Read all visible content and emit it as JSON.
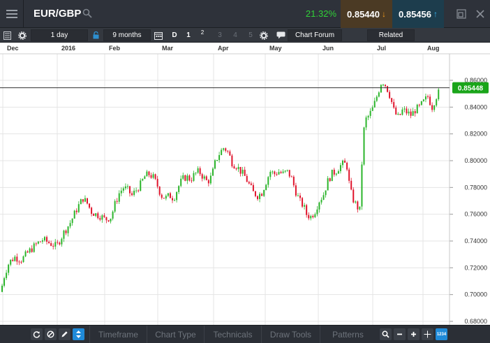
{
  "header": {
    "symbol": "EUR/GBP",
    "change_pct": "21.32%",
    "sell_price": "0.85440",
    "buy_price": "0.85456",
    "colors": {
      "sell_bg": "#4b3a24",
      "buy_bg": "#1d3d4d",
      "change": "#31d138",
      "sell_arrow": "#f39a1c",
      "buy_arrow": "#35b4f2"
    }
  },
  "toolbar": {
    "interval": "1 day",
    "range": "9 months",
    "period_d": "D",
    "period_1": "1",
    "period_2": "2",
    "period_3": "3",
    "period_4": "4",
    "period_5": "5",
    "chart_forum": "Chart Forum",
    "related": "Related"
  },
  "bottom": {
    "tabs": [
      "Timeframe",
      "Chart Type",
      "Technicals",
      "Draw Tools",
      "Patterns"
    ],
    "scale_badge": "1234"
  },
  "chart_data": {
    "type": "candlestick",
    "x_labels": [
      "Dec",
      "2016",
      "Feb",
      "Mar",
      "Apr",
      "May",
      "Jun",
      "Jul",
      "Aug"
    ],
    "y_ticks": [
      "0.86000",
      "0.84000",
      "0.82000",
      "0.80000",
      "0.78000",
      "0.76000",
      "0.74000",
      "0.72000",
      "0.70000",
      "0.68000"
    ],
    "ylim": [
      0.676,
      0.866
    ],
    "current_price": "0.85448",
    "current_value": 0.85448,
    "up_color": "#2bb52b",
    "down_color": "#e0142c",
    "price_label_color": "#1aa51a",
    "path": [
      [
        0,
        0.702
      ],
      [
        6,
        0.716
      ],
      [
        12,
        0.724
      ],
      [
        20,
        0.728
      ],
      [
        30,
        0.726
      ],
      [
        40,
        0.732
      ],
      [
        52,
        0.738
      ],
      [
        60,
        0.741
      ],
      [
        72,
        0.738
      ],
      [
        80,
        0.736
      ],
      [
        90,
        0.746
      ],
      [
        100,
        0.754
      ],
      [
        110,
        0.765
      ],
      [
        118,
        0.772
      ],
      [
        124,
        0.768
      ],
      [
        130,
        0.762
      ],
      [
        136,
        0.76
      ],
      [
        142,
        0.759
      ],
      [
        150,
        0.756
      ],
      [
        158,
        0.758
      ],
      [
        164,
        0.768
      ],
      [
        170,
        0.776
      ],
      [
        176,
        0.78
      ],
      [
        182,
        0.778
      ],
      [
        188,
        0.774
      ],
      [
        194,
        0.778
      ],
      [
        200,
        0.782
      ],
      [
        206,
        0.788
      ],
      [
        212,
        0.79
      ],
      [
        218,
        0.788
      ],
      [
        224,
        0.782
      ],
      [
        230,
        0.774
      ],
      [
        236,
        0.772
      ],
      [
        242,
        0.774
      ],
      [
        248,
        0.772
      ],
      [
        254,
        0.78
      ],
      [
        260,
        0.786
      ],
      [
        266,
        0.788
      ],
      [
        272,
        0.786
      ],
      [
        278,
        0.79
      ],
      [
        284,
        0.792
      ],
      [
        290,
        0.788
      ],
      [
        296,
        0.784
      ],
      [
        302,
        0.788
      ],
      [
        308,
        0.8
      ],
      [
        314,
        0.806
      ],
      [
        320,
        0.81
      ],
      [
        326,
        0.806
      ],
      [
        332,
        0.798
      ],
      [
        338,
        0.796
      ],
      [
        344,
        0.792
      ],
      [
        350,
        0.788
      ],
      [
        356,
        0.782
      ],
      [
        362,
        0.776
      ],
      [
        368,
        0.774
      ],
      [
        374,
        0.776
      ],
      [
        380,
        0.784
      ],
      [
        386,
        0.792
      ],
      [
        392,
        0.79
      ],
      [
        398,
        0.792
      ],
      [
        404,
        0.79
      ],
      [
        410,
        0.792
      ],
      [
        416,
        0.788
      ],
      [
        422,
        0.778
      ],
      [
        428,
        0.77
      ],
      [
        434,
        0.766
      ],
      [
        438,
        0.76
      ],
      [
        444,
        0.758
      ],
      [
        450,
        0.762
      ],
      [
        456,
        0.77
      ],
      [
        462,
        0.774
      ],
      [
        468,
        0.784
      ],
      [
        474,
        0.79
      ],
      [
        480,
        0.792
      ],
      [
        486,
        0.796
      ],
      [
        492,
        0.798
      ],
      [
        496,
        0.796
      ],
      [
        500,
        0.78
      ],
      [
        504,
        0.772
      ],
      [
        510,
        0.766
      ],
      [
        516,
        0.762
      ],
      [
        518,
        0.812
      ],
      [
        522,
        0.83
      ],
      [
        528,
        0.834
      ],
      [
        534,
        0.84
      ],
      [
        540,
        0.85
      ],
      [
        546,
        0.86
      ],
      [
        552,
        0.856
      ],
      [
        558,
        0.848
      ],
      [
        564,
        0.836
      ],
      [
        570,
        0.832
      ],
      [
        576,
        0.838
      ],
      [
        582,
        0.836
      ],
      [
        588,
        0.834
      ],
      [
        594,
        0.838
      ],
      [
        600,
        0.84
      ],
      [
        606,
        0.844
      ],
      [
        612,
        0.848
      ],
      [
        618,
        0.84
      ],
      [
        624,
        0.848
      ],
      [
        630,
        0.853
      ]
    ]
  }
}
